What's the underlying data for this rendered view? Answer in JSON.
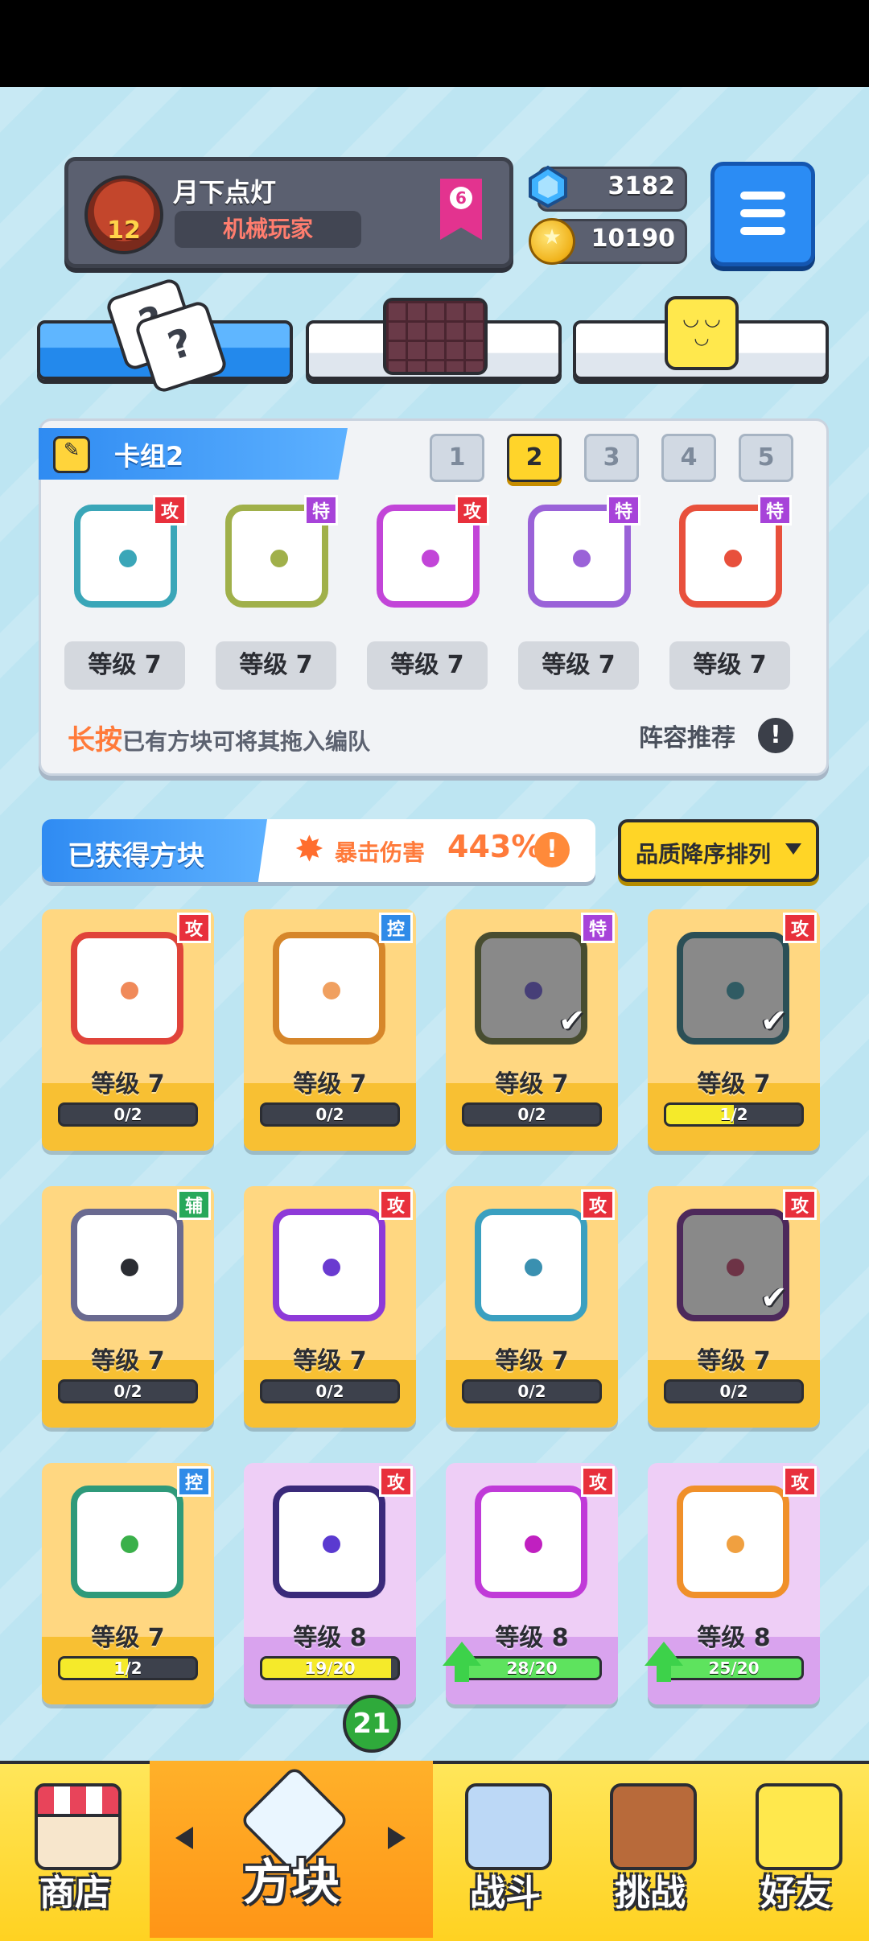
{
  "player": {
    "name": "月下点灯",
    "title": "机械玩家",
    "level": "12",
    "rank": "6"
  },
  "currency": {
    "gems": "3182",
    "coins": "10190"
  },
  "deck": {
    "title": "卡组2",
    "tabs": [
      "1",
      "2",
      "3",
      "4",
      "5"
    ],
    "active_tab": "2",
    "cards": [
      {
        "tag": "攻",
        "tag_type": "atk",
        "level": "等级 7",
        "color": "#3aa6b8"
      },
      {
        "tag": "特",
        "tag_type": "sp",
        "level": "等级 7",
        "color": "#a0b04a"
      },
      {
        "tag": "攻",
        "tag_type": "atk",
        "level": "等级 7",
        "color": "#c245d8"
      },
      {
        "tag": "特",
        "tag_type": "sp",
        "level": "等级 7",
        "color": "#9a62d8"
      },
      {
        "tag": "特",
        "tag_type": "sp",
        "level": "等级 7",
        "color": "#e8503c"
      }
    ],
    "hint_bold": "长按",
    "hint_rest": "已有方块可将其拖入编队",
    "recommend": "阵容推荐",
    "recommend_icon": "!"
  },
  "obtained": {
    "title": "已获得方块",
    "crit_label": "暴击伤害",
    "crit_value": "443%",
    "crit_icon": "!",
    "sort_label": "品质降序排列"
  },
  "blocks": [
    {
      "tag": "攻",
      "tag_type": "atk",
      "level": "等级 7",
      "progress": "0/2",
      "fill": 0,
      "bg": "gold",
      "color": "#e0443a",
      "dot": "#f08a5a",
      "owned": false
    },
    {
      "tag": "控",
      "tag_type": "ctl",
      "level": "等级 7",
      "progress": "0/2",
      "fill": 0,
      "bg": "gold",
      "color": "#d6862a",
      "dot": "#f0a060",
      "owned": false
    },
    {
      "tag": "特",
      "tag_type": "sp",
      "level": "等级 7",
      "progress": "0/2",
      "fill": 0,
      "bg": "gold",
      "color": "#6f7a3a",
      "dot": "#6a5ad8",
      "owned": true
    },
    {
      "tag": "攻",
      "tag_type": "atk",
      "level": "等级 7",
      "progress": "1/2",
      "fill": 0.5,
      "bg": "gold",
      "color": "#2f7f8e",
      "dot": "#3a9aaa",
      "owned": true
    },
    {
      "tag": "辅",
      "tag_type": "sup",
      "level": "等级 7",
      "progress": "0/2",
      "fill": 0,
      "bg": "gold",
      "color": "#6a6a90",
      "dot": "#2b2d33",
      "owned": false
    },
    {
      "tag": "攻",
      "tag_type": "atk",
      "level": "等级 7",
      "progress": "0/2",
      "fill": 0,
      "bg": "gold",
      "color": "#8e3ad8",
      "dot": "#6a3ad0",
      "owned": false
    },
    {
      "tag": "攻",
      "tag_type": "atk",
      "level": "等级 7",
      "progress": "0/2",
      "fill": 0,
      "bg": "gold",
      "color": "#3aa0c0",
      "dot": "#3a90b0",
      "owned": false
    },
    {
      "tag": "攻",
      "tag_type": "atk",
      "level": "等级 7",
      "progress": "0/2",
      "fill": 0,
      "bg": "gold",
      "color": "#7a2a9a",
      "dot": "#c0406a",
      "owned": true
    },
    {
      "tag": "控",
      "tag_type": "ctl",
      "level": "等级 7",
      "progress": "1/2",
      "fill": 0.5,
      "bg": "gold",
      "color": "#2f9a7a",
      "dot": "#3ab04a",
      "owned": false
    },
    {
      "tag": "攻",
      "tag_type": "atk",
      "level": "等级 8",
      "progress": "19/20",
      "fill": 0.95,
      "bg": "purple",
      "color": "#3a2a7a",
      "dot": "#5a3ad0",
      "owned": false
    },
    {
      "tag": "攻",
      "tag_type": "atk",
      "level": "等级 8",
      "progress": "28/20",
      "fill": 1,
      "bg": "purple",
      "color": "#c03ad8",
      "dot": "#c020c0",
      "owned": false,
      "upgrade": true
    },
    {
      "tag": "攻",
      "tag_type": "atk",
      "level": "等级 8",
      "progress": "25/20",
      "fill": 1,
      "bg": "purple",
      "color": "#f0902a",
      "dot": "#f0a040",
      "owned": false,
      "upgrade": true
    }
  ],
  "nav": {
    "shop": "商店",
    "blocks": "方块",
    "battle": "战斗",
    "challenge": "挑战",
    "friends": "好友",
    "blocks_badge": "21"
  },
  "icons": {
    "gem": "gem-icon",
    "coin": "coin-icon",
    "menu": "hamburger-menu-icon",
    "pencil": "pencil-icon",
    "check": "checkmark-icon",
    "upgrade": "up-arrow-icon"
  }
}
